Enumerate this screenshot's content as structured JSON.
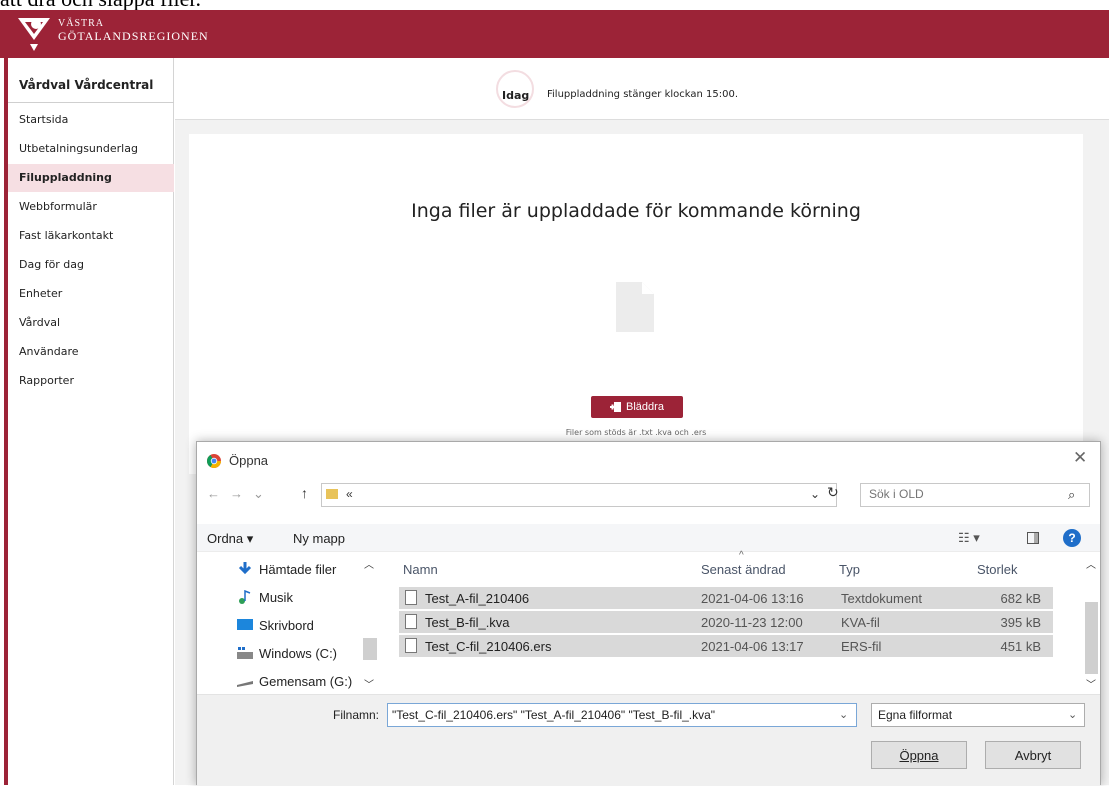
{
  "page_top_text": "att dra och släppa filer.",
  "brand": {
    "line1": "VÄSTRA",
    "line2": "GÖTALANDSREGIONEN",
    "color": "#9c2337"
  },
  "sidebar": {
    "title": "Vårdval Vårdcentral",
    "items": [
      {
        "label": "Startsida",
        "active": false
      },
      {
        "label": "Utbetalningsunderlag",
        "active": false
      },
      {
        "label": "Filuppladdning",
        "active": true
      },
      {
        "label": "Webbformulär",
        "active": false
      },
      {
        "label": "Fast läkarkontakt",
        "active": false
      },
      {
        "label": "Dag för dag",
        "active": false
      },
      {
        "label": "Enheter",
        "active": false
      },
      {
        "label": "Vårdval",
        "active": false
      },
      {
        "label": "Användare",
        "active": false
      },
      {
        "label": "Rapporter",
        "active": false
      }
    ]
  },
  "info": {
    "today": "Idag",
    "message": "Filuppladdning stänger klockan 15:00."
  },
  "upload": {
    "heading": "Inga filer är uppladdade för kommande körning",
    "browse_label": "Bläddra",
    "supported": "Filer som stöds är .txt .kva och .ers"
  },
  "dialog": {
    "title": "Öppna",
    "address_chevron": "«",
    "search_placeholder": "Sök i OLD",
    "toolbar": {
      "organize": "Ordna ▾",
      "new_folder": "Ny mapp",
      "help": "?"
    },
    "nav": [
      {
        "label": "Hämtade filer",
        "icon": "download-arrow-icon"
      },
      {
        "label": "Musik",
        "icon": "music-icon"
      },
      {
        "label": "Skrivbord",
        "icon": "desktop-icon"
      },
      {
        "label": "Windows (C:)",
        "icon": "drive-icon"
      },
      {
        "label": "Gemensam (G:)",
        "icon": "network-drive-icon"
      }
    ],
    "columns": {
      "name": "Namn",
      "modified": "Senast ändrad",
      "type": "Typ",
      "size": "Storlek"
    },
    "files": [
      {
        "name": "Test_A-fil_210406",
        "modified": "2021-04-06 13:16",
        "type": "Textdokument",
        "size": "682 kB"
      },
      {
        "name": "Test_B-fil_.kva",
        "modified": "2020-11-23 12:00",
        "type": "KVA-fil",
        "size": "395 kB"
      },
      {
        "name": "Test_C-fil_210406.ers",
        "modified": "2021-04-06 13:17",
        "type": "ERS-fil",
        "size": "451 kB"
      }
    ],
    "filename_label": "Filnamn:",
    "filename_value": "\"Test_C-fil_210406.ers\" \"Test_A-fil_210406\" \"Test_B-fil_.kva\"",
    "filter": "Egna filformat",
    "open_label": "Öppna",
    "cancel_label": "Avbryt"
  }
}
